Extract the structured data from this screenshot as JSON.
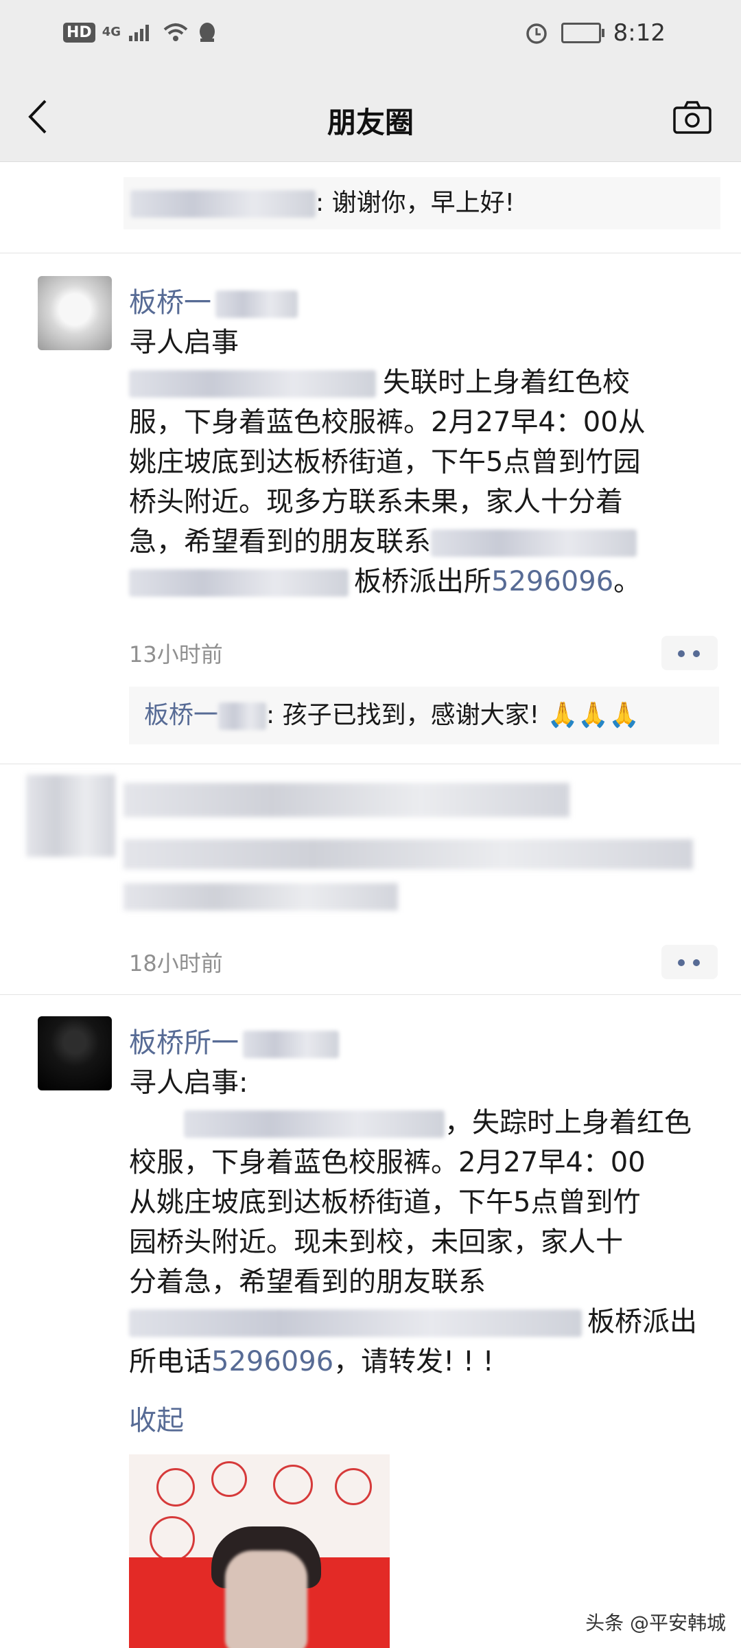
{
  "status_bar": {
    "hd": "HD",
    "network": "4G",
    "time": "8:12"
  },
  "nav": {
    "title": "朋友圈"
  },
  "top_comment": {
    "text": ": 谢谢你，早上好!"
  },
  "posts": [
    {
      "name": "板桥一",
      "lines": [
        "寻人启事",
        "失联时上身着红色校",
        "服，下身着蓝色校服裤。2月27早4：00从",
        "姚庄坡底到达板桥街道，下午5点曾到竹园",
        "桥头附近。现多方联系未果，家人十分着",
        "急，希望看到的朋友联系",
        "板桥派出所",
        "5296096",
        "。"
      ],
      "time": "13小时前",
      "comment": {
        "name": "板桥一",
        "text": ": 孩子已找到，感谢大家! 🙏🙏🙏"
      }
    },
    {
      "time": "18小时前"
    },
    {
      "name": "板桥所一",
      "lines": [
        "寻人启事:",
        "，失踪时上身着红色",
        "校服，下身着蓝色校服裤。2月27早4：00",
        "从姚庄坡底到达板桥街道，下午5点曾到竹",
        "园桥头附近。现未到校，未回家，家人十",
        "分着急，希望看到的朋友联系",
        "板桥派出",
        "所电话",
        "5296096",
        "，请转发! ! !"
      ],
      "collapse": "收起"
    }
  ],
  "watermark": "头条 @平安韩城",
  "colors": {
    "link": "#576b95",
    "bar_bg": "#ededed",
    "comment_bg": "#f7f7f7"
  },
  "icons": [
    "back-arrow-icon",
    "camera-icon",
    "more-dots-icon",
    "alarm-icon",
    "wifi-icon",
    "battery-icon"
  ]
}
